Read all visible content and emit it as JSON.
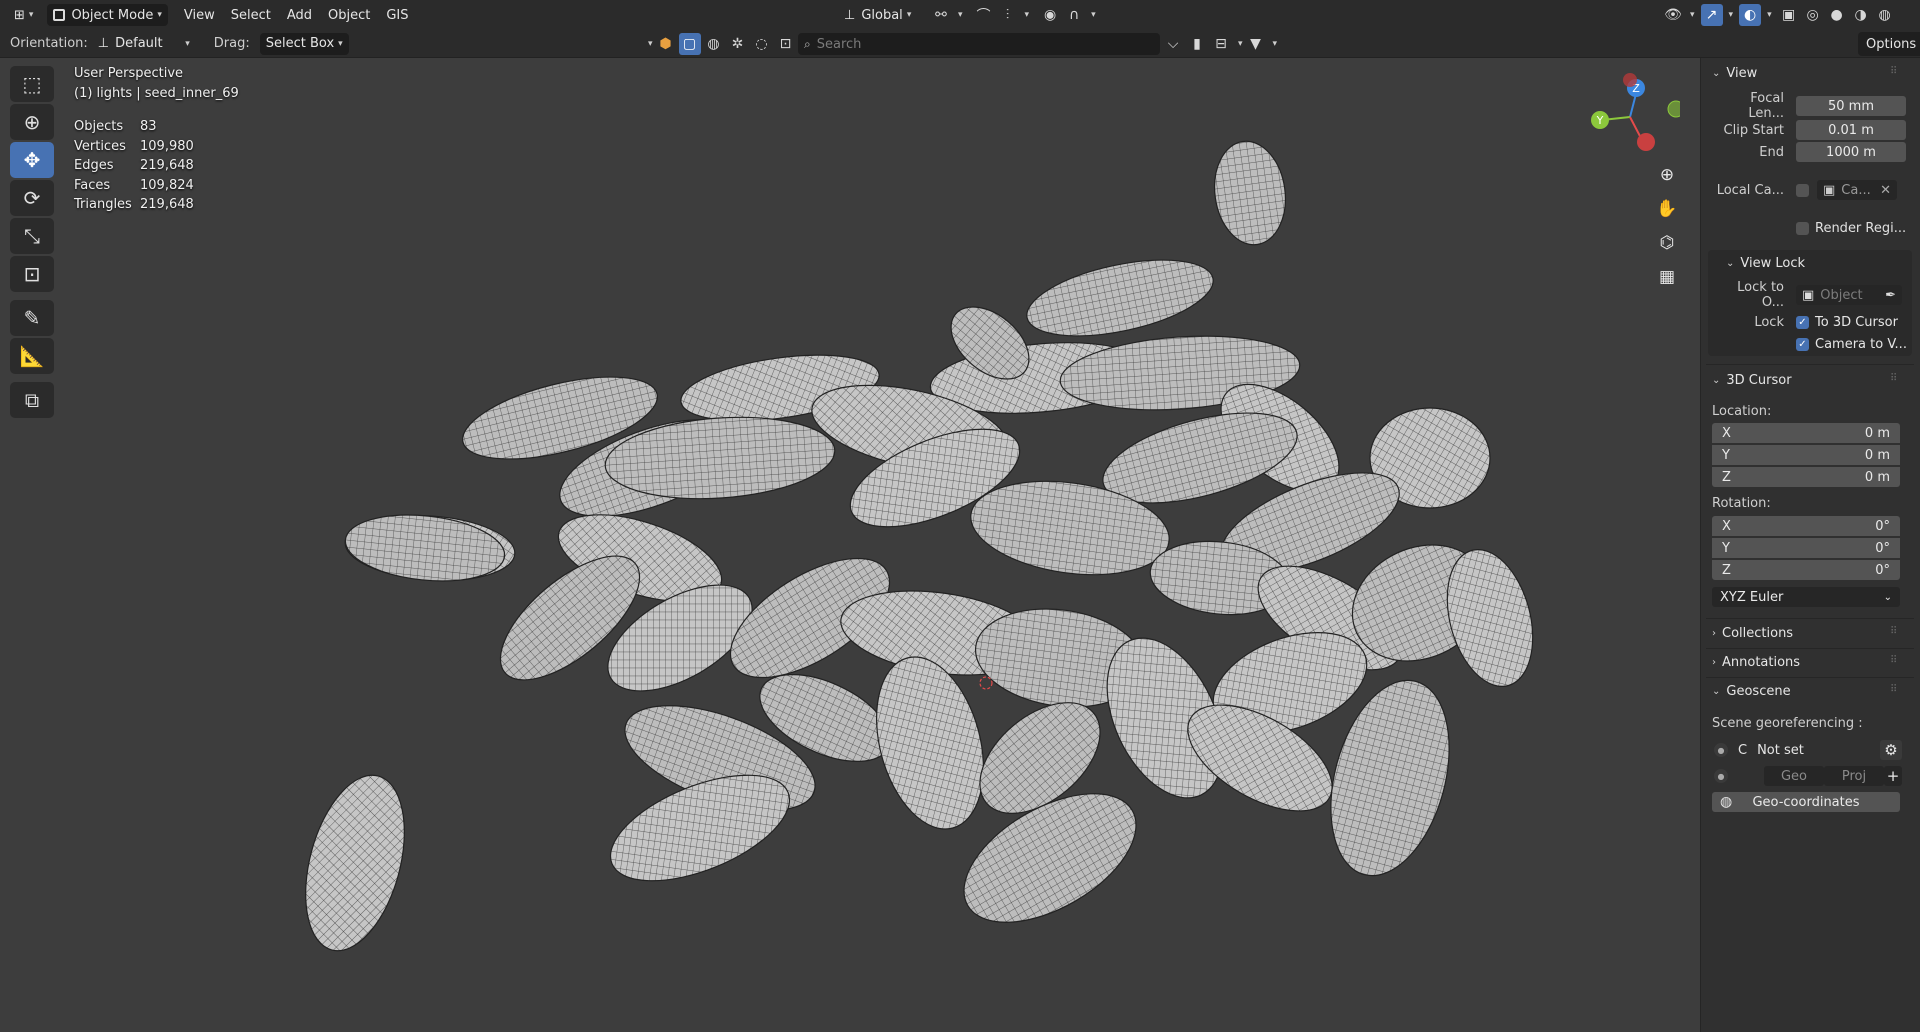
{
  "header": {
    "mode": "Object Mode",
    "menus": [
      "View",
      "Select",
      "Add",
      "Object",
      "GIS"
    ],
    "transform_orientation": "Global"
  },
  "tool_header": {
    "orientation_label": "Orientation:",
    "orientation_value": "Default",
    "drag_label": "Drag:",
    "drag_value": "Select Box",
    "search_placeholder": "Search",
    "options_label": "Options"
  },
  "viewport": {
    "title": "User Perspective",
    "collection": "(1) lights | seed_inner_69",
    "stats": [
      {
        "label": "Objects",
        "value": "83"
      },
      {
        "label": "Vertices",
        "value": "109,980"
      },
      {
        "label": "Edges",
        "value": "219,648"
      },
      {
        "label": "Faces",
        "value": "109,824"
      },
      {
        "label": "Triangles",
        "value": "219,648"
      }
    ],
    "gizmo": {
      "z": "Z",
      "y": "Y"
    }
  },
  "sidebar": {
    "view": {
      "title": "View",
      "focal_label": "Focal Len...",
      "focal_value": "50 mm",
      "clip_start_label": "Clip Start",
      "clip_start_value": "0.01 m",
      "end_label": "End",
      "end_value": "1000 m",
      "local_camera_label": "Local Ca...",
      "local_camera_value": "Ca...",
      "render_region_label": "Render Regi..."
    },
    "view_lock": {
      "title": "View Lock",
      "lock_to_label": "Lock to O...",
      "lock_to_placeholder": "Object",
      "lock_label": "Lock",
      "to_3d_cursor": "To 3D Cursor",
      "camera_to_view": "Camera to V..."
    },
    "cursor": {
      "title": "3D Cursor",
      "location_label": "Location:",
      "location": [
        {
          "axis": "X",
          "value": "0 m"
        },
        {
          "axis": "Y",
          "value": "0 m"
        },
        {
          "axis": "Z",
          "value": "0 m"
        }
      ],
      "rotation_label": "Rotation:",
      "rotation": [
        {
          "axis": "X",
          "value": "0°"
        },
        {
          "axis": "Y",
          "value": "0°"
        },
        {
          "axis": "Z",
          "value": "0°"
        }
      ],
      "rotation_mode": "XYZ Euler"
    },
    "collections_title": "Collections",
    "annotations_title": "Annotations",
    "geoscene": {
      "title": "Geoscene",
      "georef_label": "Scene georeferencing :",
      "crs_prefix": "C",
      "crs_value": "Not set",
      "geo_label": "Geo",
      "proj_label": "Proj",
      "geo_coords_button": "Geo-coordinates"
    }
  },
  "colors": {
    "accent": "#4772b3",
    "background": "#3d3d3d",
    "panel": "#303030",
    "axis_x": "#e34b4b",
    "axis_y": "#8cc83c",
    "axis_z": "#3b87e0"
  }
}
